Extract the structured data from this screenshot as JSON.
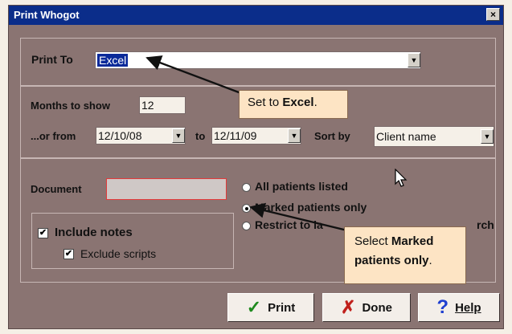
{
  "window": {
    "title": "Print Whogot",
    "close_label": "×"
  },
  "print_to": {
    "label": "Print To",
    "value": "Excel"
  },
  "months": {
    "label": "Months to show",
    "value": "12"
  },
  "range": {
    "from_label": "...or from",
    "from_value": "12/10/08",
    "to_label": "to",
    "to_value": "12/11/09"
  },
  "sort": {
    "label": "Sort by",
    "value": "Client name"
  },
  "document": {
    "label": "Document",
    "value": ""
  },
  "radios": [
    {
      "label": "All patients listed",
      "selected": false
    },
    {
      "label": "Marked patients only",
      "selected": true
    },
    {
      "label": "Restrict to la",
      "trailing": "rch",
      "selected": false
    }
  ],
  "options": {
    "include_notes": {
      "label": "Include notes",
      "checked": true
    },
    "exclude_scripts": {
      "label": "Exclude scripts",
      "checked": true
    }
  },
  "buttons": {
    "print": "Print",
    "done": "Done",
    "help": "Help"
  },
  "callouts": {
    "excel": {
      "pre": "Set to ",
      "bold": "Excel",
      "post": "."
    },
    "marked": {
      "pre": "Select ",
      "bold1": "Marked",
      "bold2": "patients only",
      "post": "."
    }
  },
  "glyphs": {
    "dropdown": "▼",
    "check": "✓",
    "cross": "✗",
    "question": "?",
    "checkbox_mark": "✔"
  },
  "colors": {
    "titlebar": "#0b2d8a",
    "dialog": "#8a7472",
    "callout": "#fde4c4",
    "check_green": "#1f8a1f",
    "cross_red": "#c0201c",
    "help_blue": "#1f3fd0"
  }
}
